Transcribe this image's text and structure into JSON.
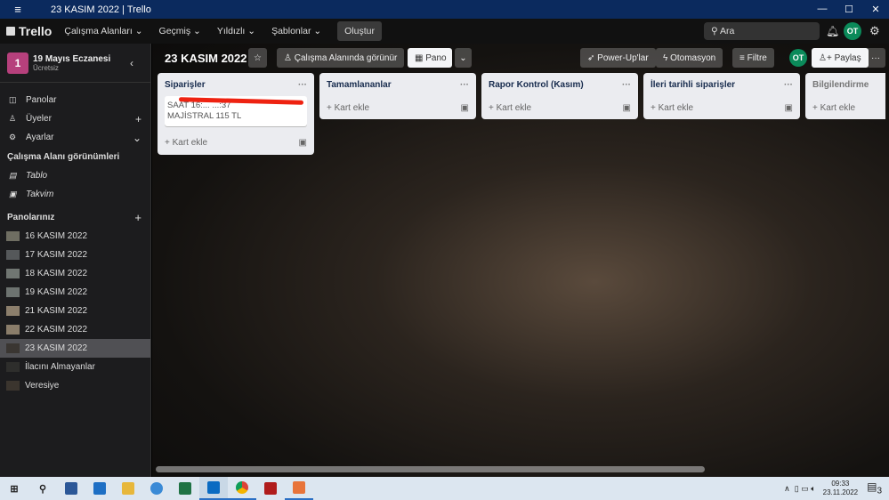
{
  "window": {
    "title": "23 KASIM 2022 | Trello",
    "menu": "≡",
    "min": "—",
    "max": "☐",
    "close": "✕"
  },
  "nav": {
    "logo": "Trello",
    "menus": [
      "Çalışma Alanları ⌄",
      "Geçmiş ⌄",
      "Yıldızlı ⌄",
      "Şablonlar ⌄"
    ],
    "create": "Oluştur",
    "search_placeholder": "Ara",
    "avatar": "OT"
  },
  "sidebar": {
    "workspace": {
      "initial": "1",
      "name": "19 Mayıs Eczanesi",
      "plan": "Ücretsiz"
    },
    "items": [
      {
        "label": "Panolar"
      },
      {
        "label": "Üyeler"
      },
      {
        "label": "Ayarlar"
      }
    ],
    "views_header": "Çalışma Alanı görünümleri",
    "views": [
      {
        "label": "Tablo"
      },
      {
        "label": "Takvim"
      }
    ],
    "boards_header": "Panolarınız",
    "boards": [
      {
        "label": "16 KASIM 2022",
        "color": "#6f6e62"
      },
      {
        "label": "17 KASIM 2022",
        "color": "#55585a"
      },
      {
        "label": "18 KASIM 2022",
        "color": "#707672"
      },
      {
        "label": "19 KASIM 2022",
        "color": "#6d7370"
      },
      {
        "label": "21 KASIM 2022",
        "color": "#8c7f6c"
      },
      {
        "label": "22 KASIM 2022",
        "color": "#8a7d6a"
      },
      {
        "label": "23 KASIM 2022",
        "color": "#3a3632"
      },
      {
        "label": "İlacını Almayanlar",
        "color": "#2e2e2c"
      },
      {
        "label": "Veresiye",
        "color": "#3b352e"
      }
    ]
  },
  "board": {
    "title": "23 KASIM 2022",
    "visibility": "Çalışma Alanında görünür",
    "view": "Pano",
    "powerups": "Power-Up'lar",
    "automation": "Otomasyon",
    "filter": "Filtre",
    "member": "OT",
    "share": "Paylaş",
    "more": "···",
    "add_card": "Kart ekle",
    "lists": [
      {
        "title": "Siparişler",
        "cards": [
          {
            "line1": "SAAT 16:...  ...:37",
            "line2": "MAJİSTRAL 115 TL"
          }
        ]
      },
      {
        "title": "Tamamlananlar",
        "cards": []
      },
      {
        "title": "Rapor Kontrol (Kasım)",
        "cards": []
      },
      {
        "title": "İleri tarihli siparişler",
        "cards": []
      },
      {
        "title": "Bilgilendirme",
        "cards": []
      }
    ]
  },
  "taskbar": {
    "time": "09:33",
    "date": "23.11.2022",
    "notifications": "3"
  }
}
